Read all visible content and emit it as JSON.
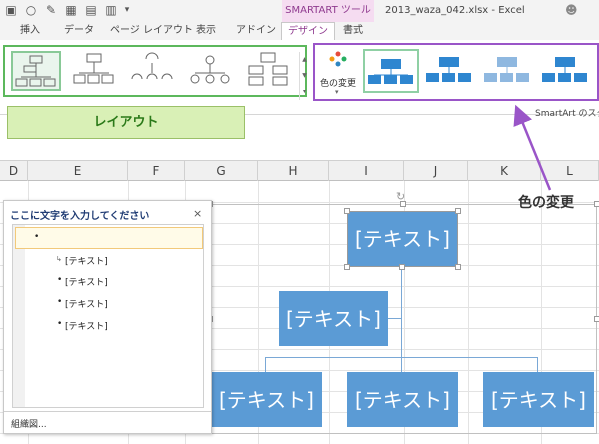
{
  "title_bar": {
    "context_tab_title": "SMARTART ツール",
    "document_title": "2013_waza_042.xlsx - Excel"
  },
  "tabs": [
    "挿入",
    "データ",
    "ページ レイアウト",
    "表示",
    "アドイン",
    "デザイン",
    "書式"
  ],
  "active_tab": "デザイン",
  "ribbon": {
    "change_colors_label": "色の変更",
    "styles_group_caption": "SmartArt のスタイル",
    "accent_color": "#5b9bd5"
  },
  "annotations": {
    "layout_label": "レイアウト",
    "color_change_label": "色の変更",
    "layout_highlight_color": "#5cb85c",
    "color_highlight_color": "#9a55c8"
  },
  "columns": [
    "D",
    "E",
    "F",
    "G",
    "H",
    "I",
    "J",
    "K",
    "L"
  ],
  "text_pane": {
    "title": "ここに文字を入力してください",
    "close_label": "×",
    "first_bullet": "•",
    "items": [
      "[テキスト]",
      "[テキスト]",
      "[テキスト]",
      "[テキスト]"
    ],
    "footer_link": "組織図..."
  },
  "smartart": {
    "top_box": "[テキスト]",
    "assistant_box": "[テキスト]",
    "child_boxes": [
      "[テキスト]",
      "[テキスト]",
      "[テキスト]"
    ]
  }
}
